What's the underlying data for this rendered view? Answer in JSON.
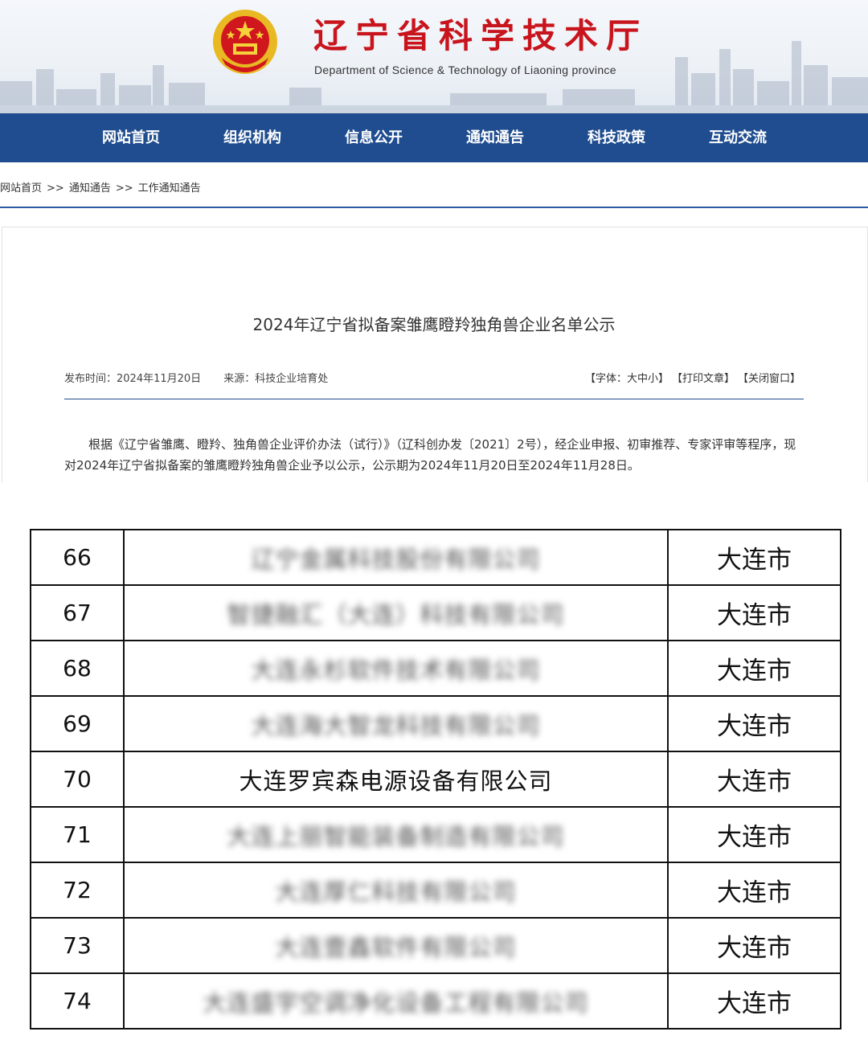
{
  "header": {
    "title": "辽宁省科学技术厅",
    "subtitle": "Department of Science & Technology of Liaoning province",
    "brand_red": "#c8151d",
    "nav_blue": "#1f4d8f"
  },
  "nav": {
    "items": [
      {
        "label": "网站首页"
      },
      {
        "label": "组织机构"
      },
      {
        "label": "信息公开"
      },
      {
        "label": "通知通告"
      },
      {
        "label": "科技政策"
      },
      {
        "label": "互动交流"
      }
    ]
  },
  "breadcrumb": {
    "items": [
      "网站首页",
      "通知通告",
      "工作通知通告"
    ],
    "separator": ">>"
  },
  "article": {
    "title": "2024年辽宁省拟备案雏鹰瞪羚独角兽企业名单公示",
    "publish_label": "发布时间：",
    "publish_date": "2024年11月20日",
    "source_label": "来源：",
    "source": "科技企业培育处",
    "font_label": "【字体：大中小】",
    "print_label": "【打印文章】",
    "close_label": "【关闭窗口】",
    "paragraph": "根据《辽宁省雏鹰、瞪羚、独角兽企业评价办法（试行）》（辽科创办发〔2021〕2号），经企业申报、初审推荐、专家评审等程序，现对2024年辽宁省拟备案的雏鹰瞪羚独角兽企业予以公示，公示期为2024年11月20日至2024年11月28日。"
  },
  "table": {
    "rows": [
      {
        "no": "66",
        "name": "辽宁金属科技股份有限公司",
        "city": "大连市",
        "blurred": true
      },
      {
        "no": "67",
        "name": "智捷融汇（大连）科技有限公司",
        "city": "大连市",
        "blurred": true
      },
      {
        "no": "68",
        "name": "大连永杉软件技术有限公司",
        "city": "大连市",
        "blurred": true
      },
      {
        "no": "69",
        "name": "大连海大智龙科技有限公司",
        "city": "大连市",
        "blurred": true
      },
      {
        "no": "70",
        "name": "大连罗宾森电源设备有限公司",
        "city": "大连市",
        "blurred": false
      },
      {
        "no": "71",
        "name": "大连上丽智能装备制造有限公司",
        "city": "大连市",
        "blurred": true
      },
      {
        "no": "72",
        "name": "大连厚仁科技有限公司",
        "city": "大连市",
        "blurred": true
      },
      {
        "no": "73",
        "name": "大连壹鑫软件有限公司",
        "city": "大连市",
        "blurred": true
      },
      {
        "no": "74",
        "name": "大连盛宇空调净化设备工程有限公司",
        "city": "大连市",
        "blurred": true
      }
    ]
  }
}
